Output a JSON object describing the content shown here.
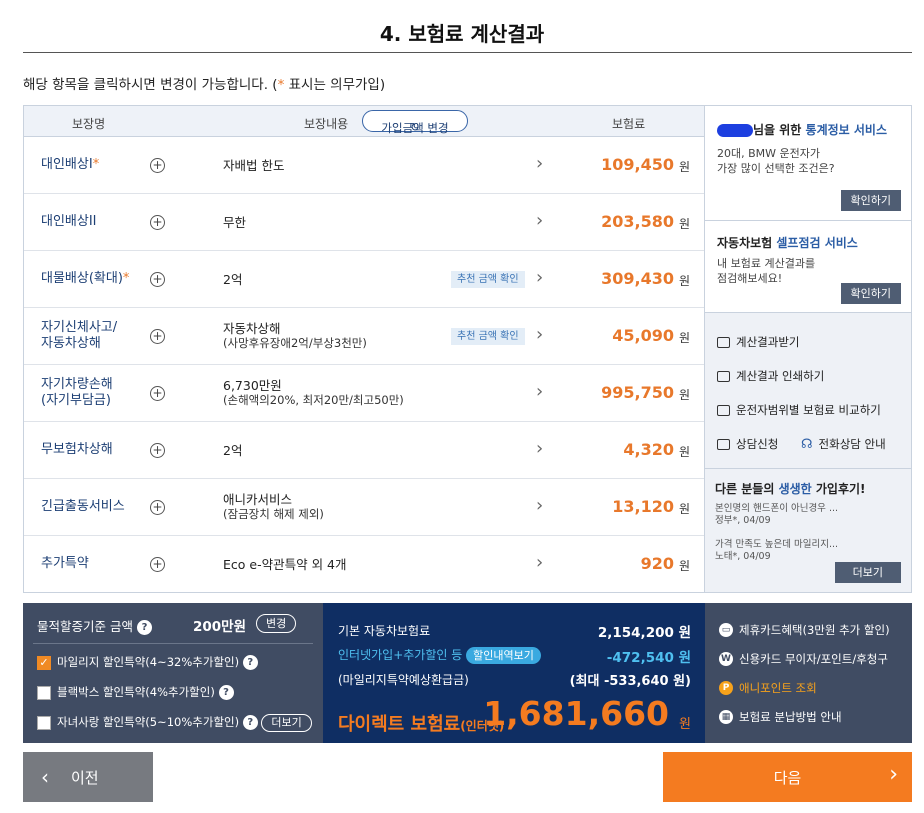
{
  "title": "4. 보험료 계산결과",
  "notice": {
    "prefix": "해당 항목을 클릭하시면 변경이 가능합니다. (",
    "star": "*",
    "suffix": " 표시는 의무가입)"
  },
  "table": {
    "col_name": "보장명",
    "col_content": "보장내용",
    "change_amount_label": "가입금액 변경",
    "col_premium": "보험료",
    "currency": "원",
    "recommend_label": "추천 금액 확인",
    "rows": [
      {
        "name": "대인배상I",
        "required": "*",
        "desc": "자배법 한도",
        "sub": "",
        "amount": "109,450"
      },
      {
        "name": "대인배상II",
        "required": "",
        "desc": "무한",
        "sub": "",
        "amount": "203,580"
      },
      {
        "name": "대물배상(확대)",
        "required": "*",
        "desc": "2억",
        "sub": "",
        "amount": "309,430"
      },
      {
        "name": "자기신체사고/",
        "name2": "자동차상해",
        "required": "",
        "desc": "자동차상해",
        "sub": "(사망후유장애2억/부상3천만)",
        "amount": "45,090"
      },
      {
        "name": "자기차량손해",
        "name2": "(자기부담금)",
        "required": "",
        "desc": "6,730만원",
        "sub": "(손해액의20%, 최저20만/최고50만)",
        "amount": "995,750"
      },
      {
        "name": "무보험차상해",
        "required": "",
        "desc": "2억",
        "sub": "",
        "amount": "4,320"
      },
      {
        "name": "긴급출동서비스",
        "required": "",
        "desc": "애니카서비스",
        "sub": "(잠금장치 해제 제외)",
        "amount": "13,120"
      },
      {
        "name": "추가특약",
        "required": "",
        "desc": "Eco e-약관특약 외 4개",
        "sub": "",
        "amount": "920"
      }
    ]
  },
  "side": {
    "stats_title_a": "님을 위한 ",
    "stats_title_b": "통계정보 서비스",
    "stats_text1": "20대, BMW 운전자가",
    "stats_text2": "가장 많이 선택한 조건은?",
    "confirm": "확인하기",
    "self_title_a": "자동차보험 ",
    "self_title_b": "셀프점검 서비스",
    "self_text1": "내 보험료 계산결과를",
    "self_text2": "점검해보세요!",
    "links": [
      "계산결과받기",
      "계산결과 인쇄하기",
      "운전자범위별 보험료 비교하기",
      "상담신청",
      "전화상담 안내"
    ],
    "review_title_a": "다른 분들의 ",
    "review_title_b": "생생한",
    "review_title_c": " 가입후기!",
    "reviews": [
      {
        "text": "본인명의 핸드폰이 아닌경우 ...",
        "meta": "정부*, 04/09"
      },
      {
        "text": "가격 만족도 높은데 마일리지...",
        "meta": "노태*, 04/09"
      }
    ],
    "more": "더보기"
  },
  "bottom": {
    "property_label": "물적할증기준 금액",
    "property_value": "200만원",
    "change": "변경",
    "options": [
      {
        "label": "마일리지 할인특약(4~32%추가할인)",
        "checked": true
      },
      {
        "label": "블랙박스 할인특약(4%추가할인)",
        "checked": false
      },
      {
        "label": "자녀사랑 할인특약(5~10%추가할인)",
        "checked": false
      }
    ],
    "more": "더보기",
    "base_label": "기본 자동차보험료",
    "base_value": "2,154,200 원",
    "discount_label": "인터넷가입+추가할인 등",
    "discount_btn": "할인내역보기",
    "discount_value": "-472,540 원",
    "mileage_label": "(마일리지특약예상환급금)",
    "mileage_value": "(최대 -533,640 원)",
    "total_label": "다이렉트 보험료",
    "total_sub": "(인터넷)",
    "total_value": "1,681,660",
    "total_unit": "원",
    "benefits": [
      "제휴카드혜택(3만원 추가 할인)",
      "신용카드 무이자/포인트/후청구",
      "애니포인트 조회",
      "보험료 분납방법 안내"
    ]
  },
  "nav": {
    "prev": "이전",
    "next": "다음"
  }
}
